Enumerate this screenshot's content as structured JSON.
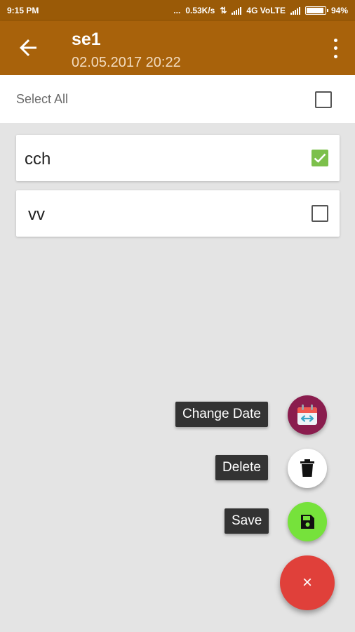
{
  "status_bar": {
    "time": "9:15 PM",
    "network_speed": "0.53K/s",
    "network_type": "4G VoLTE",
    "battery_percent": "94%",
    "battery_level": 0.94
  },
  "app_bar": {
    "title": "se1",
    "subtitle": "02.05.2017 20:22",
    "back_icon": "arrow-left",
    "menu_icon": "more-vert"
  },
  "select_all": {
    "label": "Select All",
    "checked": false
  },
  "items": [
    {
      "label": "cch",
      "checked": true
    },
    {
      "label": "vv",
      "checked": false
    }
  ],
  "fab_menu": {
    "actions": [
      {
        "label": "Change Date",
        "icon": "calendar-icon",
        "color": "#8a1d4e"
      },
      {
        "label": "Delete",
        "icon": "trash-icon",
        "color": "#ffffff"
      },
      {
        "label": "Save",
        "icon": "floppy-icon",
        "color": "#76e23b"
      }
    ],
    "close_glyph": "×",
    "close_color": "#e0403a"
  },
  "colors": {
    "app_bar": "#a8620b",
    "status_bar": "#9a5a07",
    "check_green": "#7cc04b"
  }
}
